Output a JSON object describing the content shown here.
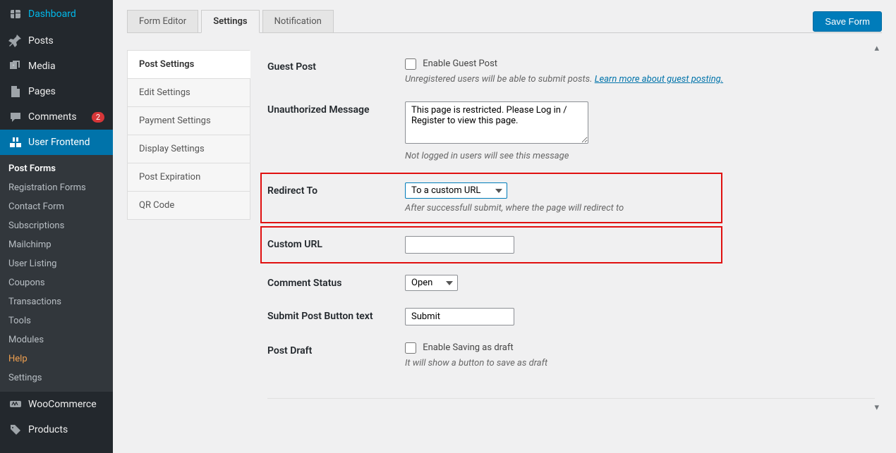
{
  "sidebar": {
    "dashboard": "Dashboard",
    "posts": "Posts",
    "media": "Media",
    "pages": "Pages",
    "comments": "Comments",
    "comments_badge": "2",
    "user_frontend": "User Frontend",
    "woocommerce": "WooCommerce",
    "products": "Products"
  },
  "submenu": {
    "post_forms": "Post Forms",
    "registration_forms": "Registration Forms",
    "contact_form": "Contact Form",
    "subscriptions": "Subscriptions",
    "mailchimp": "Mailchimp",
    "user_listing": "User Listing",
    "coupons": "Coupons",
    "transactions": "Transactions",
    "tools": "Tools",
    "modules": "Modules",
    "help": "Help",
    "settings": "Settings"
  },
  "tabs": {
    "form_editor": "Form Editor",
    "settings": "Settings",
    "notification": "Notification"
  },
  "save_button": "Save Form",
  "subnav": {
    "post_settings": "Post Settings",
    "edit_settings": "Edit Settings",
    "payment_settings": "Payment Settings",
    "display_settings": "Display Settings",
    "post_expiration": "Post Expiration",
    "qr_code": "QR Code"
  },
  "form": {
    "guest_post": {
      "label": "Guest Post",
      "checkbox": "Enable Guest Post",
      "help": "Unregistered users will be able to submit posts. ",
      "link": "Learn more about guest posting."
    },
    "unauthorized": {
      "label": "Unauthorized Message",
      "value": "This page is restricted. Please Log in / Register to view this page.",
      "help": "Not logged in users will see this message"
    },
    "redirect_to": {
      "label": "Redirect To",
      "value": "To a custom URL",
      "help": "After successfull submit, where the page will redirect to"
    },
    "custom_url": {
      "label": "Custom URL",
      "value": ""
    },
    "comment_status": {
      "label": "Comment Status",
      "value": "Open"
    },
    "submit_button": {
      "label": "Submit Post Button text",
      "value": "Submit"
    },
    "post_draft": {
      "label": "Post Draft",
      "checkbox": "Enable Saving as draft",
      "help": "It will show a button to save as draft"
    }
  }
}
